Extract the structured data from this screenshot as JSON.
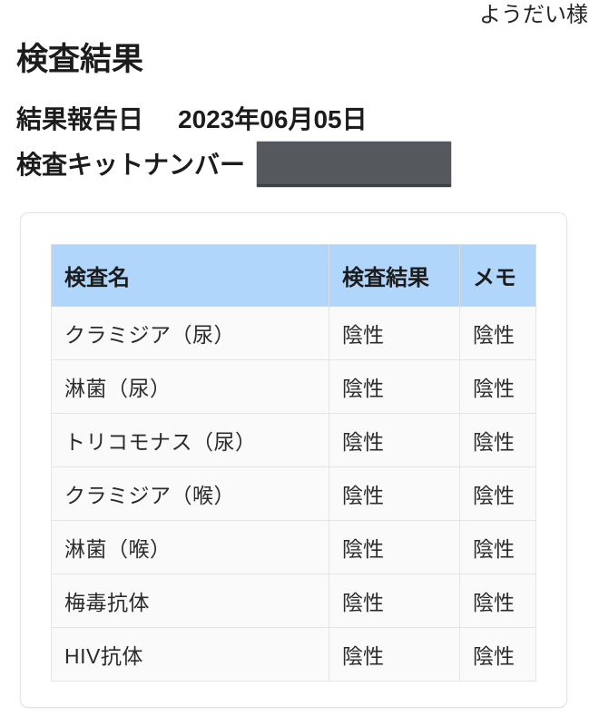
{
  "header": {
    "user_name": "ようだい様"
  },
  "page": {
    "title": "検査結果",
    "report_date_label": "結果報告日",
    "report_date_value": "2023年06月05日",
    "kit_number_label": "検査キットナンバー",
    "kit_number_value": "",
    "kit_number_redacted": true
  },
  "results_table": {
    "columns": [
      "検査名",
      "検査結果",
      "メモ"
    ],
    "rows": [
      {
        "name": "クラミジア（尿）",
        "result": "陰性",
        "memo": "陰性"
      },
      {
        "name": "淋菌（尿）",
        "result": "陰性",
        "memo": "陰性"
      },
      {
        "name": "トリコモナス（尿）",
        "result": "陰性",
        "memo": "陰性"
      },
      {
        "name": "クラミジア（喉）",
        "result": "陰性",
        "memo": "陰性"
      },
      {
        "name": "淋菌（喉）",
        "result": "陰性",
        "memo": "陰性"
      },
      {
        "name": "梅毒抗体",
        "result": "陰性",
        "memo": "陰性"
      },
      {
        "name": "HIV抗体",
        "result": "陰性",
        "memo": "陰性"
      }
    ]
  },
  "colors": {
    "header_blue": "#b0d6fb",
    "row_background": "#fafafa",
    "cell_border": "#e4e4e4",
    "text_primary": "#1c1c1c",
    "redaction_gray": "#55595d",
    "card_border": "#e3e3e3"
  }
}
